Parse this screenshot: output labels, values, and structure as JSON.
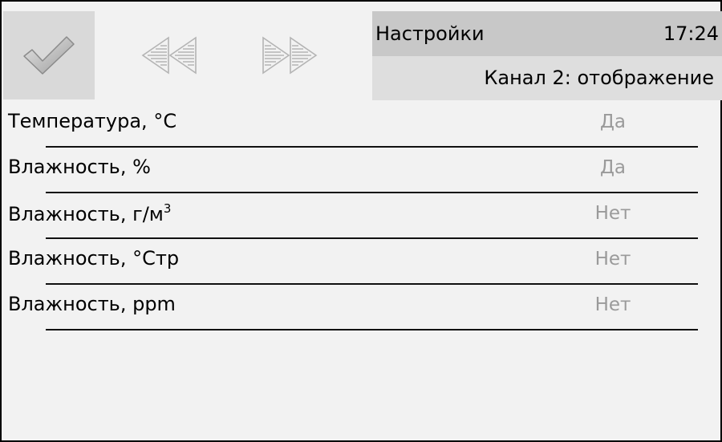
{
  "toolbar": {
    "ok_icon": "checkmark-icon",
    "prev_icon": "rewind-icon",
    "next_icon": "fast-forward-icon"
  },
  "header": {
    "title": "Настройки",
    "time": "17:24",
    "subtitle": "Канал 2: отображение"
  },
  "items": [
    {
      "label": "Температура, °C",
      "value": "Да"
    },
    {
      "label": "Влажность, %",
      "value": "Да"
    },
    {
      "label": "Влажность, г/м",
      "label_sup": "3",
      "value": "Нет"
    },
    {
      "label": "Влажность, °Стр",
      "value": "Нет"
    },
    {
      "label": "Влажность, ppm",
      "value": "Нет"
    }
  ],
  "colors": {
    "panel_bg": "#f2f2f2",
    "header_bg": "#c8c8c8",
    "subheader_bg": "#dedede",
    "ok_button_bg": "#d9d9d9",
    "value_text": "#9a9a9a"
  }
}
